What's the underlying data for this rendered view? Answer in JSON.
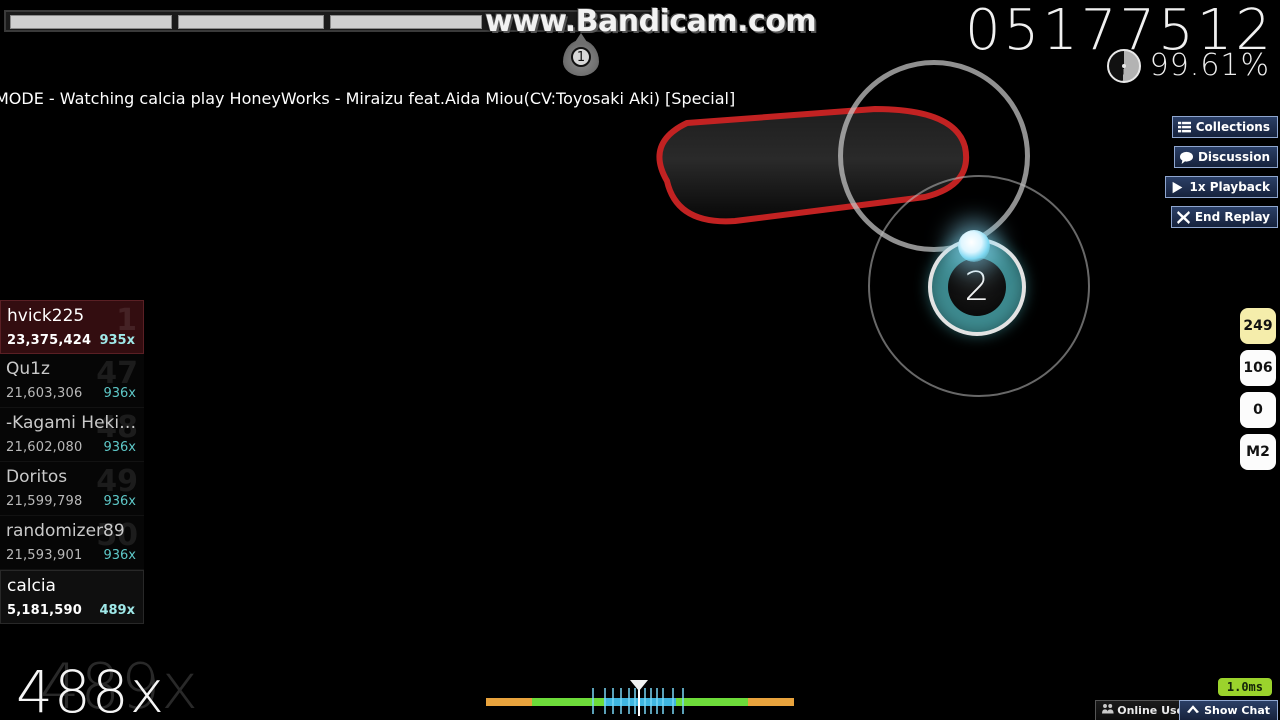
{
  "watermark": "www.Bandicam.com",
  "hud": {
    "score": "05177512",
    "accuracy": "99.61%",
    "accuracy_icon": "pie-progress-icon",
    "mode_title": "MODE - Watching calcia play HoneyWorks - Miraizu feat.Aida Miou(CV:Toyosaki Aki) [Special]",
    "combo": "488x",
    "combo_ghost": "489x",
    "slider_marker_number": "1"
  },
  "health_bar": {
    "segments": 3
  },
  "playfield": {
    "hit_circle_number": "2",
    "hit_circle_color": "#3d8a8f",
    "slider_border_color": "#c22222",
    "approach_circle_color": "#c8c8c8",
    "cursor": "cursor-dot"
  },
  "leaderboard": [
    {
      "rank": "1",
      "name": "hvick225",
      "score": "23,375,424",
      "combo": "935x",
      "style": "top"
    },
    {
      "rank": "47",
      "name": "Qu1z",
      "score": "21,603,306",
      "combo": "936x",
      "style": "normal"
    },
    {
      "rank": "48",
      "name": "-Kagami Hekiru…",
      "score": "21,602,080",
      "combo": "936x",
      "style": "normal"
    },
    {
      "rank": "49",
      "name": "Doritos",
      "score": "21,599,798",
      "combo": "936x",
      "style": "normal"
    },
    {
      "rank": "50",
      "name": "randomizer89",
      "score": "21,593,901",
      "combo": "936x",
      "style": "normal"
    },
    {
      "rank": "",
      "name": "calcia",
      "score": "5,181,590",
      "combo": "489x",
      "style": "self"
    }
  ],
  "buttons": [
    {
      "label": "Collections",
      "icon": "list-icon"
    },
    {
      "label": "Discussion",
      "icon": "speech-bubble-icon"
    },
    {
      "label": "1x Playback",
      "icon": "play-icon"
    },
    {
      "label": "End Replay",
      "icon": "close-x-icon"
    }
  ],
  "stat_boxes": [
    {
      "value": "249",
      "highlight": true
    },
    {
      "value": "106",
      "highlight": false
    },
    {
      "value": "0",
      "highlight": false
    },
    {
      "value": "M2",
      "highlight": false
    }
  ],
  "status_bar": {
    "latency": "1.0ms",
    "online_users": "Online Users",
    "show_chat": "Show Chat"
  },
  "hit_error": {
    "ticks": [
      106,
      118,
      126,
      134,
      142,
      148,
      158,
      164,
      170,
      176,
      186,
      196
    ]
  }
}
